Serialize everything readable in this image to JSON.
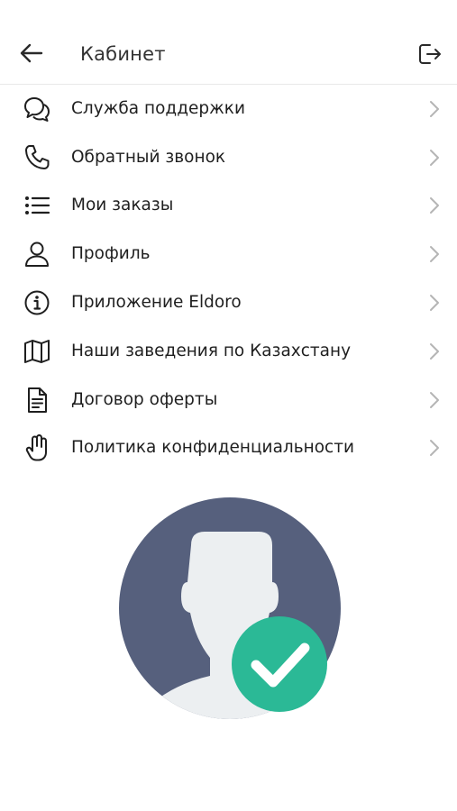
{
  "header": {
    "title": "Кабинет",
    "back_icon": "arrow-left-icon",
    "logout_icon": "logout-icon"
  },
  "menu": {
    "items": [
      {
        "label": "Служба поддержки",
        "icon": "chat-bubbles-icon"
      },
      {
        "label": "Обратный звонок",
        "icon": "phone-icon"
      },
      {
        "label": "Мои заказы",
        "icon": "list-icon"
      },
      {
        "label": "Профиль",
        "icon": "user-icon"
      },
      {
        "label": "Приложение Eldoro",
        "icon": "info-icon"
      },
      {
        "label": "Наши заведения по Казахстану",
        "icon": "map-icon"
      },
      {
        "label": "Договор оферты",
        "icon": "document-icon"
      },
      {
        "label": "Политика конфиденциальности",
        "icon": "hand-icon"
      }
    ],
    "chevron_icon": "chevron-right-icon"
  },
  "avatar": {
    "icon": "verified-user-icon",
    "colors": {
      "background": "#56607d",
      "silhouette": "#eceff1",
      "badge": "#2bb996",
      "check": "#ffffff"
    }
  }
}
